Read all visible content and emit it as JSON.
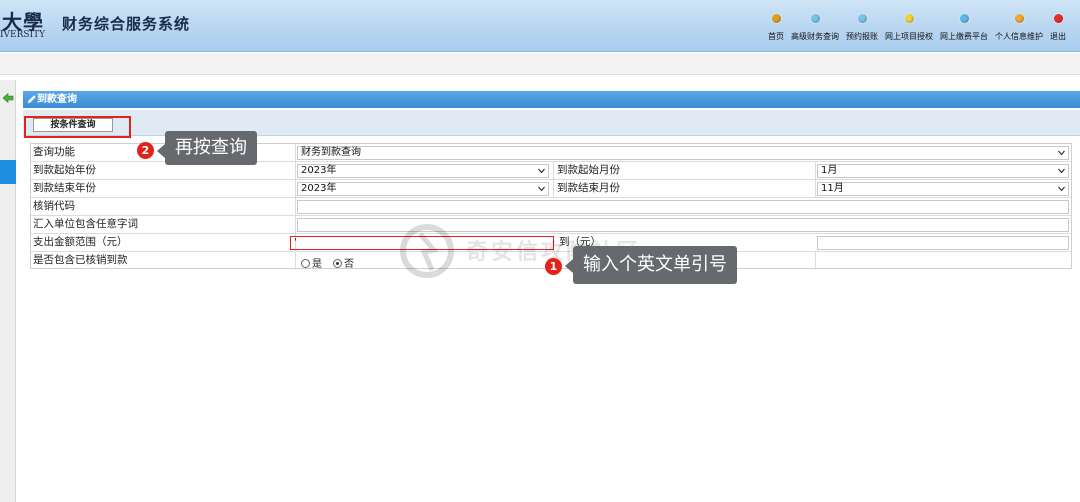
{
  "header": {
    "logo_text": "大學",
    "logo_sub": "IVERSITY",
    "title": "财务综合服务系统",
    "nav": [
      {
        "label": "首页",
        "color": "#e2a020",
        "icon": "home-icon"
      },
      {
        "label": "高级财务查询",
        "color": "#7cc3ea",
        "icon": "advanced-query-icon"
      },
      {
        "label": "预约报账",
        "color": "#7cc3ea",
        "icon": "reservation-icon"
      },
      {
        "label": "网上项目授权",
        "color": "#f0d23a",
        "icon": "project-auth-icon"
      },
      {
        "label": "网上缴费平台",
        "color": "#5fb8e6",
        "icon": "payment-icon"
      },
      {
        "label": "个人信息维护",
        "color": "#f0a830",
        "icon": "profile-icon"
      },
      {
        "label": "退出",
        "color": "#e8302a",
        "icon": "logout-icon"
      }
    ]
  },
  "panel": {
    "title": "到款查询",
    "tab_label": "按条件查询"
  },
  "form": {
    "query_function": {
      "label": "查询功能",
      "value": "财务到款查询"
    },
    "start_year": {
      "label": "到款起始年份",
      "value": "2023年"
    },
    "start_month": {
      "label": "到款起始月份",
      "value": "1月"
    },
    "end_year": {
      "label": "到款结束年份",
      "value": "2023年"
    },
    "end_month": {
      "label": "到款结束月份",
      "value": "11月"
    },
    "write_off_code": {
      "label": "核销代码",
      "value": ""
    },
    "remitter_keyword": {
      "label": "汇入单位包含任意字词",
      "value": ""
    },
    "amount_range": {
      "label": "支出金额范围（元）",
      "from_value": "'",
      "to_label": "到（元）",
      "to_value": ""
    },
    "include_written_off": {
      "label": "是否包含已核销到款",
      "yes": "是",
      "no": "否",
      "selected": "否"
    }
  },
  "annotations": {
    "step1": {
      "number": "1",
      "text": "输入个英文单引号"
    },
    "step2": {
      "number": "2",
      "text": "再按查询"
    }
  },
  "watermark": {
    "text": "奇安信攻防社区"
  },
  "colors": {
    "accent": "#3b8bd6",
    "highlight": "#e2231a"
  }
}
